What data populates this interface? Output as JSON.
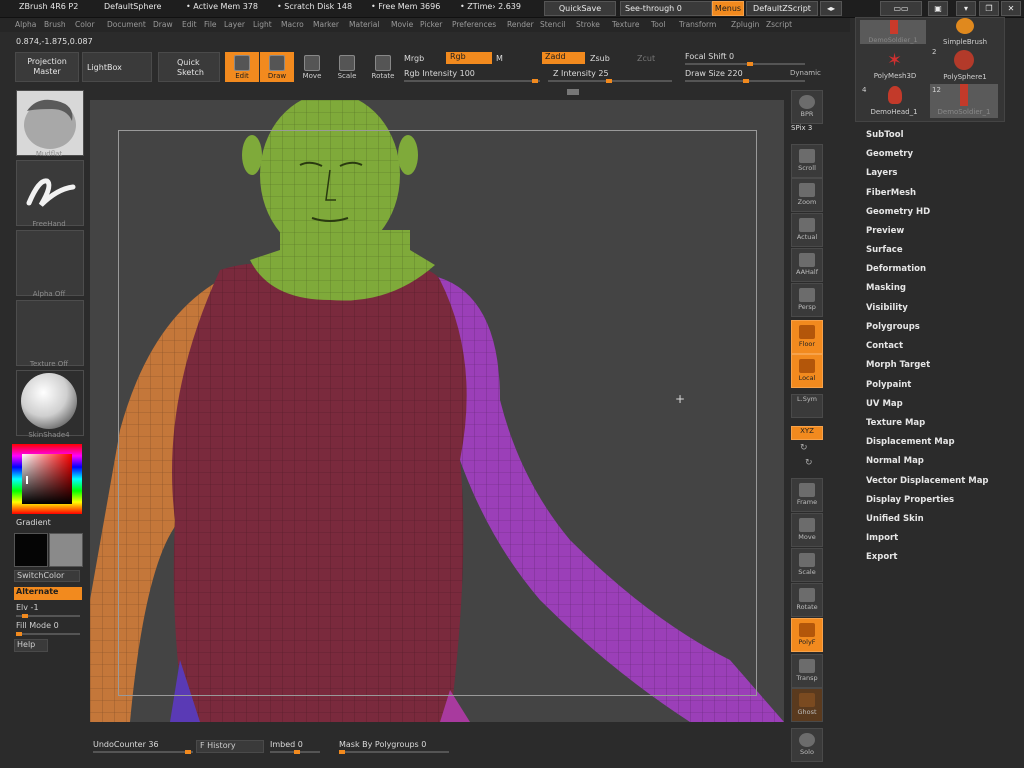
{
  "titlebar": {
    "app": "ZBrush 4R6 P2",
    "document": "DefaultSphere",
    "active_mem": "• Active Mem 378",
    "scratch_disk": "• Scratch Disk 148",
    "free_mem": "• Free Mem 3696",
    "ztime": "• ZTime› 2.639",
    "quicksave": "QuickSave",
    "see_through": "See-through  0",
    "menus": "Menus",
    "default_zscript": "DefaultZScript"
  },
  "menubar": [
    "Alpha",
    "Brush",
    "Color",
    "Document",
    "Draw",
    "Edit",
    "File",
    "Layer",
    "Light",
    "Macro",
    "Marker",
    "Material",
    "Movie",
    "Picker",
    "Preferences",
    "Render",
    "Stencil",
    "Stroke",
    "Texture",
    "Tool",
    "Transform",
    "Zplugin",
    "Zscript"
  ],
  "coords": "0.874,-1.875,0.087",
  "shelf": {
    "projection_master": "Projection Master",
    "lightbox": "LightBox",
    "quick_sketch": "Quick Sketch",
    "edit": "Edit",
    "draw": "Draw",
    "move": "Move",
    "scale": "Scale",
    "rotate": "Rotate",
    "mrgb": "Mrgb",
    "rgb": "Rgb",
    "m": "M",
    "rgb_intensity": "Rgb Intensity 100",
    "zadd": "Zadd",
    "zsub": "Zsub",
    "zcut": "Zcut",
    "z_intensity": "Z Intensity 25",
    "focal_shift": "Focal Shift 0",
    "draw_size": "Draw Size 220",
    "dynamic": "Dynamic"
  },
  "left": {
    "brush_caption": "Mudflat",
    "stroke_caption": "FreeHand",
    "alpha_caption": "Alpha Off",
    "texture_caption": "Texture Off",
    "material_caption": "SkinShade4",
    "gradient": "Gradient",
    "switch_color": "SwitchColor",
    "alternate": "Alternate",
    "elv": "Elv -1",
    "fill_mode": "Fill Mode 0",
    "help": "Help"
  },
  "righttools": [
    {
      "id": "bpr",
      "label": "BPR"
    },
    {
      "id": "spix",
      "label": "SPix 3"
    },
    {
      "id": "scroll",
      "label": "Scroll"
    },
    {
      "id": "zoom",
      "label": "Zoom"
    },
    {
      "id": "actual",
      "label": "Actual"
    },
    {
      "id": "aahalf",
      "label": "AAHalf"
    },
    {
      "id": "persp",
      "label": "Persp"
    },
    {
      "id": "floor",
      "label": "Floor"
    },
    {
      "id": "local",
      "label": "Local"
    },
    {
      "id": "lsym",
      "label": "L.Sym"
    },
    {
      "id": "xyz",
      "label": "XYZ"
    },
    {
      "id": "frame",
      "label": "Frame"
    },
    {
      "id": "move",
      "label": "Move"
    },
    {
      "id": "scale",
      "label": "Scale"
    },
    {
      "id": "rotate",
      "label": "Rotate"
    },
    {
      "id": "polyf",
      "label": "PolyF"
    },
    {
      "id": "transp",
      "label": "Transp"
    },
    {
      "id": "ghost",
      "label": "Ghost"
    },
    {
      "id": "solo",
      "label": "Solo"
    }
  ],
  "subtools_top": [
    {
      "label": "DemoSoldier_1"
    },
    {
      "label": "SimpleBrush"
    },
    {
      "label": "PolyMesh3D"
    },
    {
      "label": "PolySphere1"
    },
    {
      "label": "DemoHead_1"
    },
    {
      "label": "DemoSoldier_1"
    }
  ],
  "subtool_counts": {
    "polysphere": "2",
    "demohead": "4",
    "soldier": "12"
  },
  "tool_menu": [
    "SubTool",
    "Geometry",
    "Layers",
    "FiberMesh",
    "Geometry HD",
    "Preview",
    "Surface",
    "Deformation",
    "Masking",
    "Visibility",
    "Polygroups",
    "Contact",
    "Morph Target",
    "Polypaint",
    "UV Map",
    "Texture Map",
    "Displacement Map",
    "Normal Map",
    "Vector Displacement Map",
    "Display Properties",
    "Unified Skin",
    "Import",
    "Export"
  ],
  "bottom": {
    "undo_counter": "UndoCounter 36",
    "history": "F History",
    "imbed": "Imbed 0",
    "mask_by_polygroups": "Mask By Polygroups 0"
  },
  "colors": {
    "accent": "#f28a1e",
    "head": "#7faa3a",
    "torso": "#7a2a3d",
    "left_arm": "#c4773a",
    "right_arm": "#9b3fb8"
  }
}
